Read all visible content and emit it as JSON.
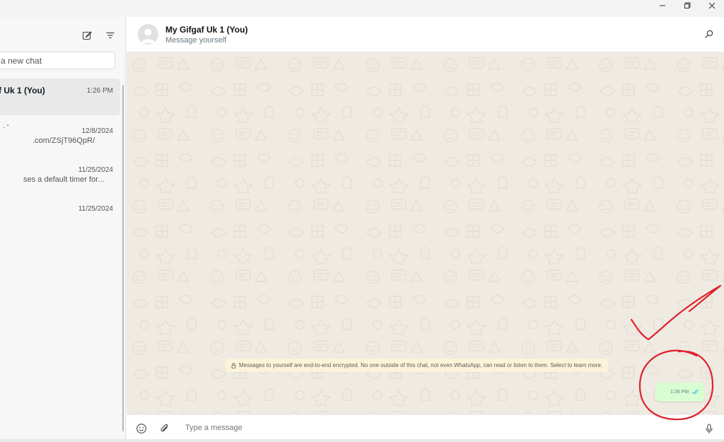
{
  "window": {
    "controls": [
      "minimize",
      "restore",
      "close"
    ]
  },
  "sidebar": {
    "compose_icon": "new-chat-icon",
    "filter_icon": "filter-icon",
    "search_placeholder": "a new chat",
    "chats": [
      {
        "name": "f Uk 1 (You)",
        "time": "1:26 PM",
        "snippet": ""
      },
      {
        "name": "",
        "time": "12/8/2024",
        "snippet": ".com/ZSjT96QpR/",
        "dots": "· '"
      },
      {
        "name": "",
        "time": "11/25/2024",
        "snippet": "ses a default timer for..."
      },
      {
        "name": "",
        "time": "11/25/2024",
        "snippet": ""
      }
    ]
  },
  "chat": {
    "title": "My Gifgaf Uk 1 (You)",
    "subtitle": "Message yourself",
    "search_icon": "search-icon",
    "encryption_notice": "Messages to yourself are end-to-end encrypted. No one outside of this chat, not even WhatsApp, can read or listen to them. Select to learn more.",
    "messages": [
      {
        "text": "",
        "time": "1:26 PM",
        "status": "read"
      }
    ],
    "composer": {
      "placeholder": "Type a message",
      "emoji_icon": "emoji-icon",
      "attach_icon": "paperclip-icon",
      "mic_icon": "microphone-icon"
    }
  },
  "colors": {
    "chat_background": "#efeae2",
    "outgoing_bubble": "#d9fdd3",
    "notice_background": "#fcf3d9",
    "read_ticks": "#53bdeb",
    "annotation": "#e0202a"
  }
}
